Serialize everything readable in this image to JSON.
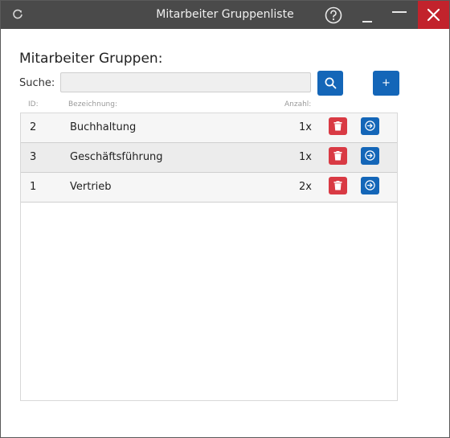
{
  "window": {
    "title": "Mitarbeiter Gruppenliste",
    "refresh_icon": "refresh-icon",
    "help_icon": "help-icon",
    "minimize_icon": "minimize-icon",
    "maximize_icon": "maximize-icon",
    "close_icon": "close-icon",
    "close_color": "#c2232c",
    "titlebar_color": "#4a4a4a"
  },
  "main": {
    "heading": "Mitarbeiter Gruppen:",
    "search": {
      "label": "Suche:",
      "value": "",
      "placeholder": ""
    },
    "search_button_icon": "search-icon",
    "add_button_label": "+",
    "accent_color": "#1466b8",
    "delete_color": "#d93a44"
  },
  "table": {
    "columns": {
      "id": "ID:",
      "name": "Bezeichnung:",
      "count": "Anzahl:"
    },
    "rows": [
      {
        "id": "2",
        "name": "Buchhaltung",
        "count": "1x"
      },
      {
        "id": "3",
        "name": "Geschäftsführung",
        "count": "1x"
      },
      {
        "id": "1",
        "name": "Vertrieb",
        "count": "2x"
      }
    ],
    "row_actions": {
      "delete_icon": "trash-icon",
      "open_icon": "arrow-circle-right-icon"
    }
  }
}
